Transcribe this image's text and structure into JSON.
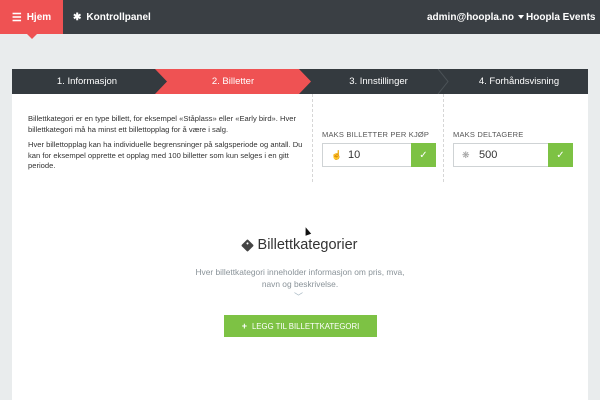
{
  "topnav": {
    "home_label": "Hjem",
    "control_panel_label": "Kontrollpanel",
    "user_email": "admin@hoopla.no",
    "brand_label": "Hoopla Events"
  },
  "steps": [
    {
      "label": "1. Informasjon",
      "active": false
    },
    {
      "label": "2. Billetter",
      "active": true
    },
    {
      "label": "3. Innstillinger",
      "active": false
    },
    {
      "label": "4. Forhåndsvisning",
      "active": false
    }
  ],
  "intro": {
    "paragraph1": "Billettkategori er en type billett, for eksempel «Ståplass» eller «Early bird». Hver billettkategori må ha minst ett billettopplag for å være i salg.",
    "paragraph2": "Hver billettopplag kan ha individuelle begrensninger på salgsperiode og antall. Du kan for eksempel opprette et opplag med 100 billetter som kun selges i en gitt periode."
  },
  "limits": {
    "max_per_purchase": {
      "label": "MAKS BILLETTER PER KJØP",
      "value": "10"
    },
    "max_attendees": {
      "label": "MAKS DELTAGERE",
      "value": "500"
    }
  },
  "categories": {
    "title": "Billettkategorier",
    "description": "Hver billettkategori inneholder informasjon om pris, mva, navn og beskrivelse.",
    "add_button_label": "LEGG TIL BILLETTKATEGORI"
  },
  "colors": {
    "accent": "#ef5253",
    "nav_bg": "#3a3f44",
    "success": "#7dc244",
    "page_bg": "#e9eced"
  }
}
